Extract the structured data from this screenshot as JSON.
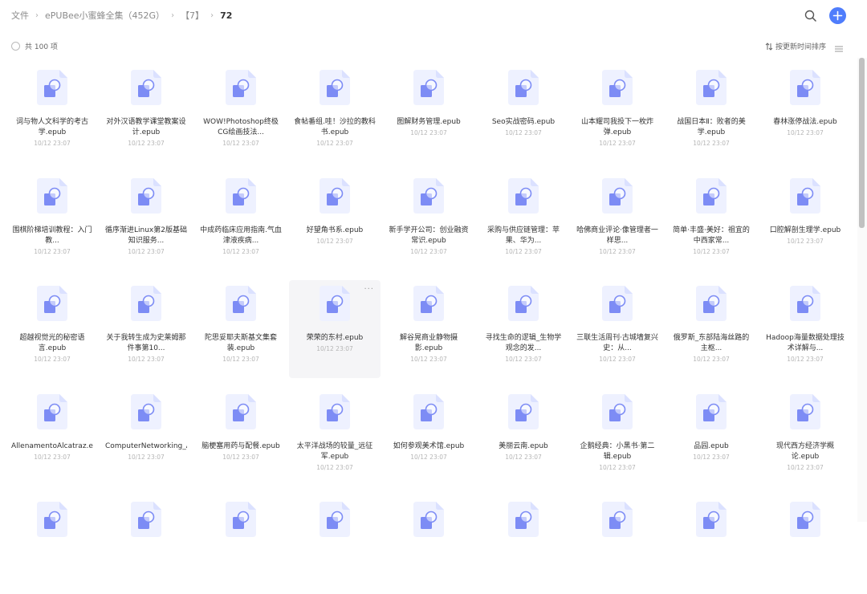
{
  "breadcrumb": {
    "items": [
      "文件",
      "ePUBee小蜜蜂全集（452G）",
      "【7】"
    ],
    "current": "72",
    "separator": "›"
  },
  "header": {
    "search_icon": "search-icon",
    "add_icon": "plus-icon"
  },
  "colors": {
    "accent": "#4f7dfc",
    "file_icon_light": "#dde4ff",
    "file_icon_dark": "#7b8cf7"
  },
  "toolbar": {
    "select_all_label": "共 100 项",
    "sort_label": "按更新时间排序",
    "sort_icon": "sort-arrows-icon",
    "view_icon": "list-view-icon"
  },
  "hovered_index": 21,
  "files": [
    {
      "name": "词与物人文科学的考古学.epub",
      "date": "10/12 23:07"
    },
    {
      "name": "对外汉语教学课堂教案设计.epub",
      "date": "10/12 23:07"
    },
    {
      "name": "WOW!Photoshop终极CG绘画技法...",
      "date": "10/12 23:07"
    },
    {
      "name": "食帖番组.哇！沙拉的教科书.epub",
      "date": "10/12 23:07"
    },
    {
      "name": "图解财务管理.epub",
      "date": "10/12 23:07"
    },
    {
      "name": "Seo实战密码.epub",
      "date": "10/12 23:07"
    },
    {
      "name": "山本耀司我投下一枚炸弹.epub",
      "date": "10/12 23:07"
    },
    {
      "name": "战国日本Ⅱ：败者的美学.epub",
      "date": "10/12 23:07"
    },
    {
      "name": "春林涨停战法.epub",
      "date": "10/12 23:07"
    },
    {
      "name": "围棋阶梯培训教程：入门教...",
      "date": "10/12 23:07"
    },
    {
      "name": "循序渐进Linux第2版基础知识服务...",
      "date": "10/12 23:07"
    },
    {
      "name": "中成药临床应用指南.气血津液疾病...",
      "date": "10/12 23:07"
    },
    {
      "name": "好望角书系.epub",
      "date": "10/12 23:07"
    },
    {
      "name": "新手学开公司：创业融资常识.epub",
      "date": "10/12 23:07"
    },
    {
      "name": "采购与供应链管理：苹果、华为...",
      "date": "10/12 23:07"
    },
    {
      "name": "哈佛商业评论·像管理者一样思...",
      "date": "10/12 23:07"
    },
    {
      "name": "简单·丰盛·美好：祖宜的中西家常...",
      "date": "10/12 23:07"
    },
    {
      "name": "口腔解剖生理学.epub",
      "date": "10/12 23:07"
    },
    {
      "name": "超越视觉光的秘密语言.epub",
      "date": "10/12 23:07"
    },
    {
      "name": "关于我转生成为史莱姆那件事第10...",
      "date": "10/12 23:07"
    },
    {
      "name": "陀思妥耶夫斯基文集套装.epub",
      "date": "10/12 23:07"
    },
    {
      "name": "荣荣的东村.epub",
      "date": "10/12 23:07"
    },
    {
      "name": "解谷晃商业静物摄影.epub",
      "date": "10/12 23:07"
    },
    {
      "name": "寻找生命的逻辑_生物学观念的发...",
      "date": "10/12 23:07"
    },
    {
      "name": "三联生活周刊·古城墙复兴史：从...",
      "date": "10/12 23:07"
    },
    {
      "name": "俄罗斯_东部陆海丝路的主枢...",
      "date": "10/12 23:07"
    },
    {
      "name": "Hadoop海量数据处理技术详解与...",
      "date": "10/12 23:07"
    },
    {
      "name": "AllenamentoAlcatraz.epub",
      "date": "10/12 23:07"
    },
    {
      "name": "ComputerNetworking_ATop-...",
      "date": "10/12 23:07"
    },
    {
      "name": "脑梗塞用药与配餐.epub",
      "date": "10/12 23:07"
    },
    {
      "name": "太平洋战场的较量_远征军.epub",
      "date": "10/12 23:07"
    },
    {
      "name": "如何参观美术馆.epub",
      "date": "10/12 23:07"
    },
    {
      "name": "美丽云南.epub",
      "date": "10/12 23:07"
    },
    {
      "name": "企鹅经典：小黑书·第二辑.epub",
      "date": "10/12 23:07"
    },
    {
      "name": "品园.epub",
      "date": "10/12 23:07"
    },
    {
      "name": "现代西方经济学概论.epub",
      "date": "10/12 23:07"
    },
    {
      "name": "",
      "date": ""
    },
    {
      "name": "",
      "date": ""
    },
    {
      "name": "",
      "date": ""
    },
    {
      "name": "",
      "date": ""
    },
    {
      "name": "",
      "date": ""
    },
    {
      "name": "",
      "date": ""
    },
    {
      "name": "",
      "date": ""
    },
    {
      "name": "",
      "date": ""
    },
    {
      "name": "",
      "date": ""
    }
  ],
  "more_label": "···"
}
